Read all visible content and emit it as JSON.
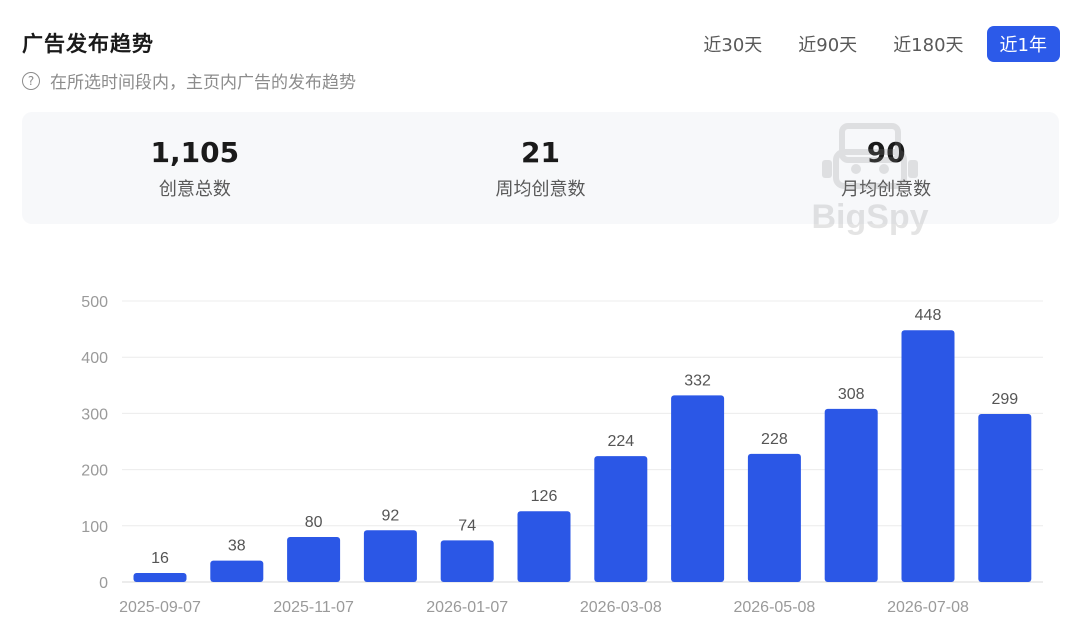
{
  "header": {
    "title": "广告发布趋势",
    "subtitle": "在所选时间段内，主页内广告的发布趋势"
  },
  "tabs": [
    {
      "label": "近30天",
      "active": false
    },
    {
      "label": "近90天",
      "active": false
    },
    {
      "label": "近180天",
      "active": false
    },
    {
      "label": "近1年",
      "active": true
    }
  ],
  "stats": [
    {
      "value": "1,105",
      "label": "创意总数"
    },
    {
      "value": "21",
      "label": "周均创意数"
    },
    {
      "value": "90",
      "label": "月均创意数"
    }
  ],
  "watermark": {
    "text": "BigSpy"
  },
  "colors": {
    "accent": "#2c5ae9",
    "bar": "#2b57e6"
  },
  "chart_data": {
    "type": "bar",
    "values": [
      16,
      38,
      80,
      92,
      74,
      126,
      224,
      332,
      228,
      308,
      448,
      299
    ],
    "x_tick_labels": [
      "2025-09-07",
      "2025-11-07",
      "2026-01-07",
      "2026-03-08",
      "2026-05-08",
      "2026-07-08"
    ],
    "y_ticks": [
      0,
      100,
      200,
      300,
      400,
      500
    ],
    "ylim": [
      0,
      500
    ],
    "grid": true,
    "data_labels": true
  }
}
